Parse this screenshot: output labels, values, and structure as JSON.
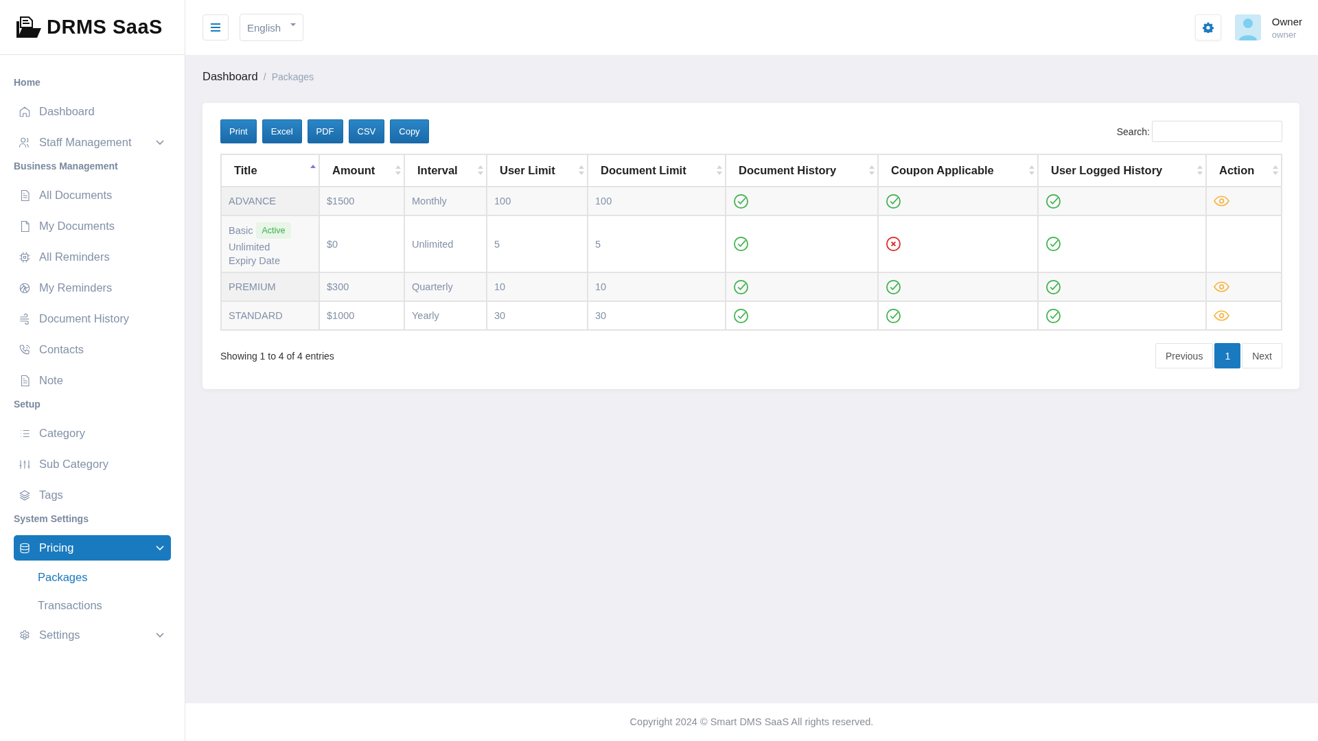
{
  "brand": {
    "name": "DRMS SaaS"
  },
  "header": {
    "language": "English",
    "user": {
      "name": "Owner",
      "role": "owner"
    }
  },
  "sidebar": {
    "sections": [
      {
        "title": "Home",
        "items": [
          {
            "label": "Dashboard",
            "selected": false
          },
          {
            "label": "Staff Management",
            "selected": false,
            "kind": "group"
          }
        ]
      },
      {
        "title": "Business Management",
        "items": [
          {
            "label": "All Documents",
            "selected": false
          },
          {
            "label": "My Documents",
            "selected": false
          },
          {
            "label": "All Reminders",
            "selected": false
          },
          {
            "label": "My Reminders",
            "selected": false
          },
          {
            "label": "Document History",
            "selected": false
          },
          {
            "label": "Contacts",
            "selected": false
          },
          {
            "label": "Note",
            "selected": false
          }
        ]
      },
      {
        "title": "Setup",
        "items": [
          {
            "label": "Category",
            "selected": false
          },
          {
            "label": "Sub Category",
            "selected": false
          },
          {
            "label": "Tags",
            "selected": false
          }
        ]
      },
      {
        "title": "System Settings",
        "items": [
          {
            "label": "Pricing",
            "selected": true,
            "kind": "group",
            "children": [
              {
                "label": "Packages",
                "selected": true
              },
              {
                "label": "Transactions",
                "selected": false
              }
            ]
          },
          {
            "label": "Settings",
            "selected": false,
            "kind": "group"
          }
        ]
      }
    ]
  },
  "breadcrumb": {
    "separator": "/",
    "items": [
      "Dashboard",
      "Packages"
    ]
  },
  "export_buttons": [
    "Print",
    "Excel",
    "PDF",
    "CSV",
    "Copy"
  ],
  "search": {
    "label": "Search:"
  },
  "table": {
    "columns": [
      {
        "label": "Title",
        "sorted": true
      },
      {
        "label": "Amount",
        "sorted": false
      },
      {
        "label": "Interval",
        "sorted": false
      },
      {
        "label": "User Limit",
        "sorted": false
      },
      {
        "label": "Document Limit",
        "sorted": false
      },
      {
        "label": "Document History",
        "sorted": false
      },
      {
        "label": "Coupon Applicable",
        "sorted": false
      },
      {
        "label": "User Logged History",
        "sorted": false
      },
      {
        "label": "Action",
        "sorted": false
      }
    ],
    "rows": [
      {
        "title": "ADVANCE",
        "amount": "$1500",
        "interval": "Monthly",
        "user_limit": "100",
        "document_limit": "100",
        "document_history": true,
        "coupon_applicable": true,
        "user_logged_history": true,
        "viewable": true
      },
      {
        "title": "Basic",
        "badge": "Active",
        "notes": [
          "Unlimited",
          "Expiry Date"
        ],
        "amount": "$0",
        "interval": "Unlimited",
        "user_limit": "5",
        "document_limit": "5",
        "document_history": true,
        "coupon_applicable": false,
        "user_logged_history": true,
        "viewable": false
      },
      {
        "title": "PREMIUM",
        "amount": "$300",
        "interval": "Quarterly",
        "user_limit": "10",
        "document_limit": "10",
        "document_history": true,
        "coupon_applicable": true,
        "user_logged_history": true,
        "viewable": true
      },
      {
        "title": "STANDARD",
        "amount": "$1000",
        "interval": "Yearly",
        "user_limit": "30",
        "document_limit": "30",
        "document_history": true,
        "coupon_applicable": true,
        "user_logged_history": true,
        "viewable": true
      }
    ]
  },
  "info": "Showing 1 to 4 of 4 entries",
  "pagination": [
    {
      "label": "Previous",
      "selected": false
    },
    {
      "label": "1",
      "selected": true
    },
    {
      "label": "Next",
      "selected": false
    }
  ],
  "footer": "Copyright 2024 © Smart DMS SaaS All rights reserved."
}
